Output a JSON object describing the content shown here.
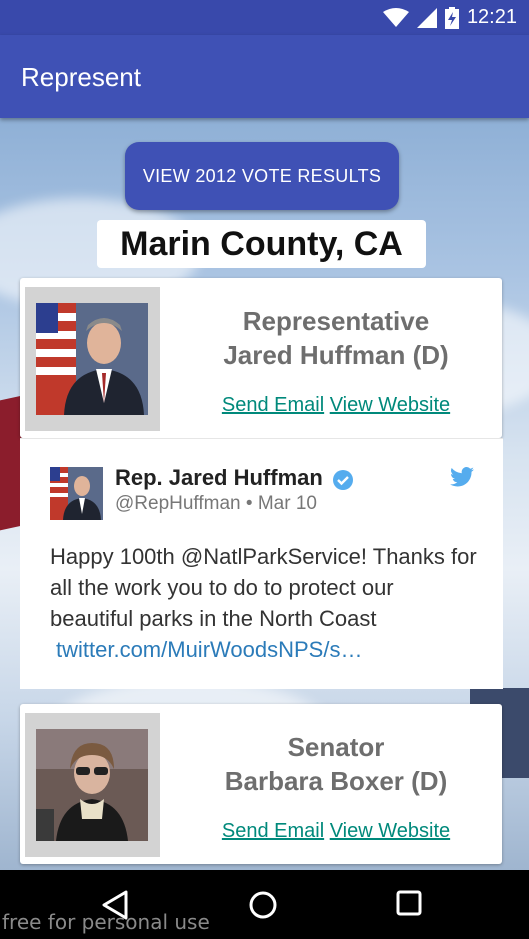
{
  "status_bar": {
    "time": "12:21"
  },
  "app_bar": {
    "title": "Represent"
  },
  "vote_button": {
    "label": "VIEW 2012 VOTE RESULTS"
  },
  "location": {
    "county": "Marin County, CA"
  },
  "representatives": [
    {
      "role": "Representative",
      "name": "Jared Huffman (D)",
      "send_email_label": "Send Email",
      "view_website_label": "View Website"
    },
    {
      "role": "Senator",
      "name": "Barbara Boxer (D)",
      "send_email_label": "Send Email",
      "view_website_label": "View Website"
    }
  ],
  "tweet": {
    "author_name": "Rep. Jared Huffman",
    "handle_line": "@RepHuffman • Mar 10",
    "text": "Happy 100th @NatlParkService! Thanks for all the work you to do to protect our beautiful parks in the North Coast",
    "link": "twitter.com/MuirWoodsNPS/s…"
  },
  "watermark": "free for personal use",
  "colors": {
    "primary": "#3f51b5",
    "primary_dark": "#3949ab",
    "link": "#00897b",
    "twitter_blue": "#55acee"
  }
}
